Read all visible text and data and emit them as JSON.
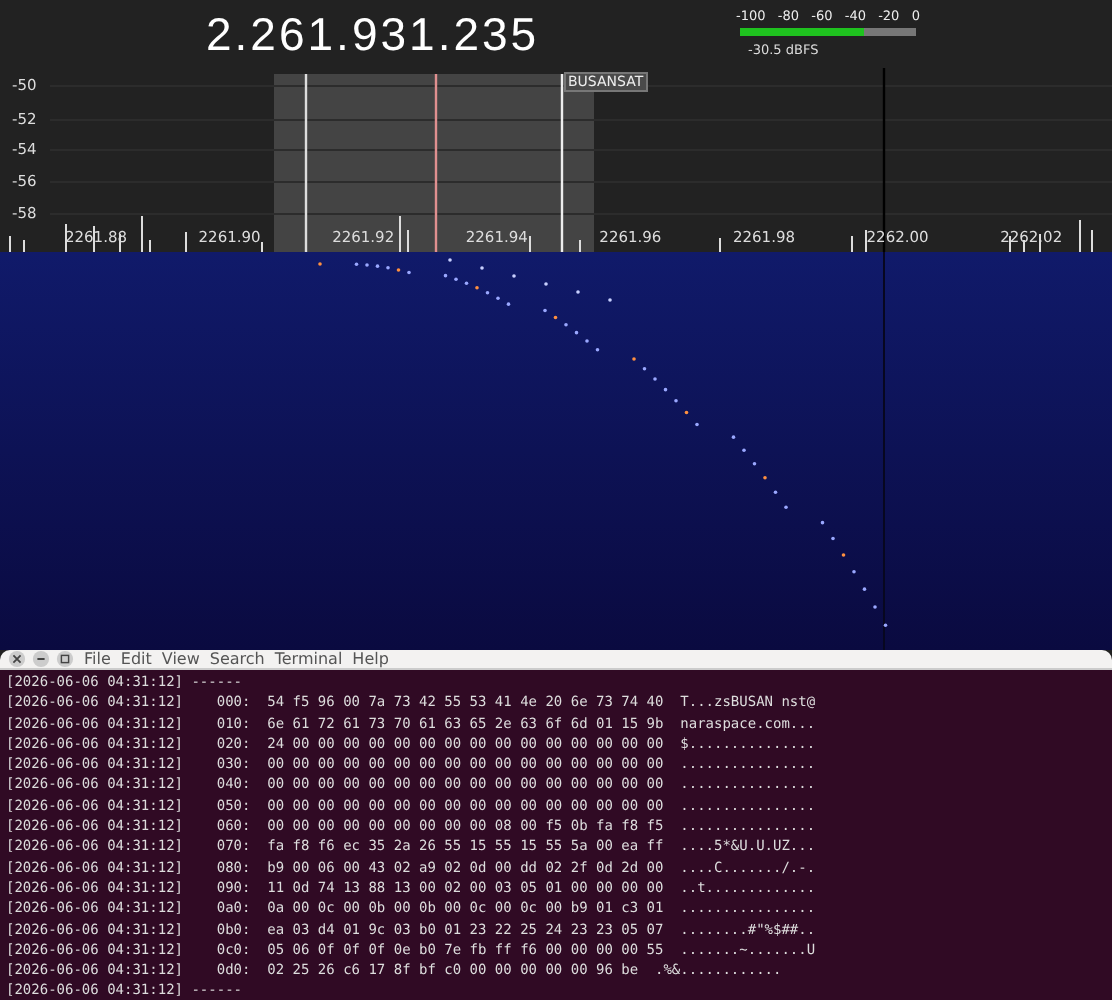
{
  "receiver": {
    "frequency": "2.261.931.235",
    "meter": {
      "ticks": [
        "-100",
        "-80",
        "-60",
        "-40",
        "-20",
        "0"
      ],
      "level": 0.7,
      "reading": "-30.5 dBFS"
    },
    "y_labels": [
      "-50",
      "-52",
      "-54",
      "-56",
      "-58"
    ],
    "x_labels": [
      "2261.88",
      "2261.90",
      "2261.92",
      "2261.94",
      "2261.96",
      "2261.98",
      "2262.00",
      "2262.02"
    ],
    "marker_label": "BUSANSAT"
  },
  "terminal": {
    "menu": [
      "File",
      "Edit",
      "View",
      "Search",
      "Terminal",
      "Help"
    ],
    "lines": [
      {
        "kind": "separator",
        "timestamp": "[2026-06-06 04:31:12]",
        "text": "------"
      },
      {
        "kind": "hex",
        "timestamp": "[2026-06-06 04:31:12]",
        "offset": "000:",
        "bytes": "54 f5 96 00 7a 73 42 55 53 41 4e 20 6e 73 74 40",
        "ascii": "T...zsBUSAN nst@"
      },
      {
        "kind": "hex",
        "timestamp": "[2026-06-06 04:31:12]",
        "offset": "010:",
        "bytes": "6e 61 72 61 73 70 61 63 65 2e 63 6f 6d 01 15 9b",
        "ascii": "naraspace.com..."
      },
      {
        "kind": "hex",
        "timestamp": "[2026-06-06 04:31:12]",
        "offset": "020:",
        "bytes": "24 00 00 00 00 00 00 00 00 00 00 00 00 00 00 00",
        "ascii": "$..............."
      },
      {
        "kind": "hex",
        "timestamp": "[2026-06-06 04:31:12]",
        "offset": "030:",
        "bytes": "00 00 00 00 00 00 00 00 00 00 00 00 00 00 00 00",
        "ascii": "................"
      },
      {
        "kind": "hex",
        "timestamp": "[2026-06-06 04:31:12]",
        "offset": "040:",
        "bytes": "00 00 00 00 00 00 00 00 00 00 00 00 00 00 00 00",
        "ascii": "................"
      },
      {
        "kind": "hex",
        "timestamp": "[2026-06-06 04:31:12]",
        "offset": "050:",
        "bytes": "00 00 00 00 00 00 00 00 00 00 00 00 00 00 00 00",
        "ascii": "................"
      },
      {
        "kind": "hex",
        "timestamp": "[2026-06-06 04:31:12]",
        "offset": "060:",
        "bytes": "00 00 00 00 00 00 00 00 00 08 00 f5 0b fa f8 f5",
        "ascii": "................"
      },
      {
        "kind": "hex",
        "timestamp": "[2026-06-06 04:31:12]",
        "offset": "070:",
        "bytes": "fa f8 f6 ec 35 2a 26 55 15 55 15 55 5a 00 ea ff",
        "ascii": "....5*&U.U.UZ..."
      },
      {
        "kind": "hex",
        "timestamp": "[2026-06-06 04:31:12]",
        "offset": "080:",
        "bytes": "b9 00 06 00 43 02 a9 02 0d 00 dd 02 2f 0d 2d 00",
        "ascii": "....C......./.-."
      },
      {
        "kind": "hex",
        "timestamp": "[2026-06-06 04:31:12]",
        "offset": "090:",
        "bytes": "11 0d 74 13 88 13 00 02 00 03 05 01 00 00 00 00",
        "ascii": "..t............."
      },
      {
        "kind": "hex",
        "timestamp": "[2026-06-06 04:31:12]",
        "offset": "0a0:",
        "bytes": "0a 00 0c 00 0b 00 0b 00 0c 00 0c 00 b9 01 c3 01",
        "ascii": "................"
      },
      {
        "kind": "hex",
        "timestamp": "[2026-06-06 04:31:12]",
        "offset": "0b0:",
        "bytes": "ea 03 d4 01 9c 03 b0 01 23 22 25 24 23 23 05 07",
        "ascii": "........#\"%$##.."
      },
      {
        "kind": "hex",
        "timestamp": "[2026-06-06 04:31:12]",
        "offset": "0c0:",
        "bytes": "05 06 0f 0f 0f 0e b0 7e fb ff f6 00 00 00 00 55",
        "ascii": ".......~.......U"
      },
      {
        "kind": "hex",
        "timestamp": "[2026-06-06 04:31:12]",
        "offset": "0d0:",
        "bytes": "02 25 26 c6 17 8f bf c0 00 00 00 00 00 96 be",
        "ascii": ".%&............"
      },
      {
        "kind": "separator",
        "timestamp": "[2026-06-06 04:31:12]",
        "text": "------"
      }
    ]
  }
}
